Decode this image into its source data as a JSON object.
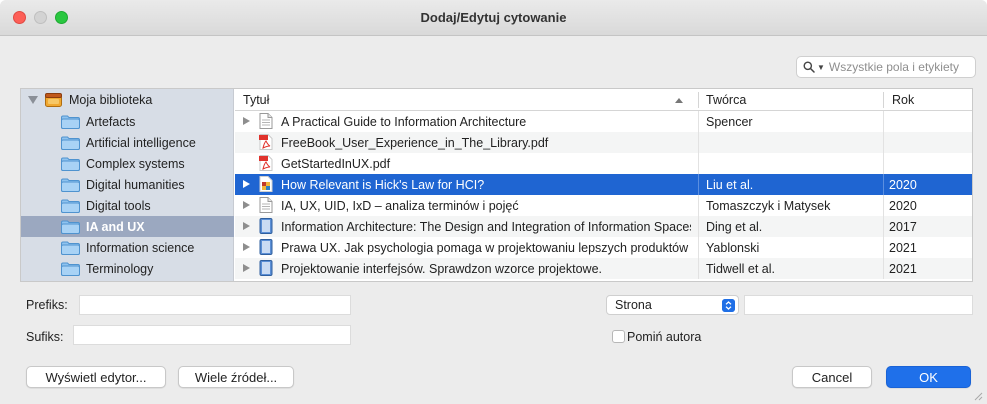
{
  "window": {
    "title": "Dodaj/Edytuj cytowanie"
  },
  "search": {
    "placeholder": "Wszystkie pola i etykiety",
    "icon": "search-icon"
  },
  "sidebar": {
    "library": "Moja biblioteka",
    "collections": [
      {
        "label": "Artefacts",
        "selected": false
      },
      {
        "label": "Artificial intelligence",
        "selected": false
      },
      {
        "label": "Complex systems",
        "selected": false
      },
      {
        "label": "Digital humanities",
        "selected": false
      },
      {
        "label": "Digital tools",
        "selected": false
      },
      {
        "label": "IA and UX",
        "selected": true
      },
      {
        "label": "Information science",
        "selected": false
      },
      {
        "label": "Terminology",
        "selected": false
      }
    ]
  },
  "table": {
    "columns": {
      "title": "Tytuł",
      "creator": "Twórca",
      "year": "Rok"
    },
    "rows": [
      {
        "expandable": true,
        "icon": "document-icon",
        "title": "A Practical Guide to Information Architecture",
        "creator": "Spencer",
        "year": "",
        "selected": false
      },
      {
        "expandable": false,
        "icon": "pdf-icon",
        "title": "FreeBook_User_Experience_in_The_Library.pdf",
        "creator": "",
        "year": "",
        "selected": false
      },
      {
        "expandable": false,
        "icon": "pdf-icon",
        "title": "GetStartedInUX.pdf",
        "creator": "",
        "year": "",
        "selected": false
      },
      {
        "expandable": true,
        "icon": "journal-article-icon",
        "title": "How Relevant is Hick's Law for HCI?",
        "creator": "Liu et al.",
        "year": "2020",
        "selected": true
      },
      {
        "expandable": true,
        "icon": "document-icon",
        "title": "IA, UX, UID, IxD – analiza terminów i pojęć",
        "creator": "Tomaszczyk i Matysek",
        "year": "2020",
        "selected": false
      },
      {
        "expandable": true,
        "icon": "book-icon",
        "title": "Information Architecture: The Design and Integration of Information Spaces",
        "creator": "Ding et al.",
        "year": "2017",
        "selected": false
      },
      {
        "expandable": true,
        "icon": "book-icon",
        "title": "Prawa UX. Jak psychologia pomaga w projektowaniu lepszych produktów i usług",
        "creator": "Yablonski",
        "year": "2021",
        "selected": false
      },
      {
        "expandable": true,
        "icon": "book-icon",
        "title": "Projektowanie interfejsów. Sprawdzon wzorce projektowe.",
        "creator": "Tidwell et al.",
        "year": "2021",
        "selected": false
      }
    ]
  },
  "form": {
    "prefix_label": "Prefiks:",
    "prefix_value": "",
    "suffix_label": "Sufiks:",
    "suffix_value": "",
    "locator_select": "Strona",
    "locator_value": "",
    "omit_author_label": "Pomiń autora",
    "omit_author_checked": false
  },
  "buttons": {
    "show_editor": "Wyświetl edytor...",
    "multiple_sources": "Wiele źródeł...",
    "cancel": "Cancel",
    "ok": "OK"
  },
  "colors": {
    "selection": "#1f65d2",
    "sidebar_selection": "#9ba8c0",
    "primary_button": "#1f70ea"
  }
}
